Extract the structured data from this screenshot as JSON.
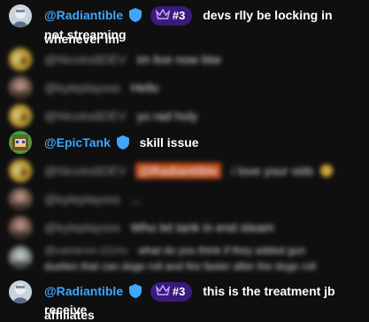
{
  "messages": [
    {
      "author": "@Radiantible",
      "badge": "#3",
      "text_line1": "devs rlly be locking in whenever im",
      "text_line2": "not streaming"
    },
    {
      "author": "@NicolodiDEV",
      "text": "im live now btw"
    },
    {
      "author": "@kyleplaysss",
      "text": "Hello"
    },
    {
      "author": "@NicolodiDEV",
      "text": "yo rad holy"
    },
    {
      "author": "@EpicTank",
      "text": "skill issue"
    },
    {
      "author": "@NicolodiDEV",
      "mention": "@Radiantible",
      "text": "i love your vids"
    },
    {
      "author": "@kyleplaysss",
      "text": "..."
    },
    {
      "author": "@kyleplaysss",
      "text": "Who let tank in end steam"
    },
    {
      "author": "@cameron-zt1mv",
      "text_line1": "what do you think if they added gun",
      "text_line2": "duelies that can doge roll and fire faster after the doge roll"
    },
    {
      "author": "@Radiantible",
      "badge": "#3",
      "text_line1": "this is the treatment jb affiliates",
      "text_line2": "receive"
    }
  ]
}
